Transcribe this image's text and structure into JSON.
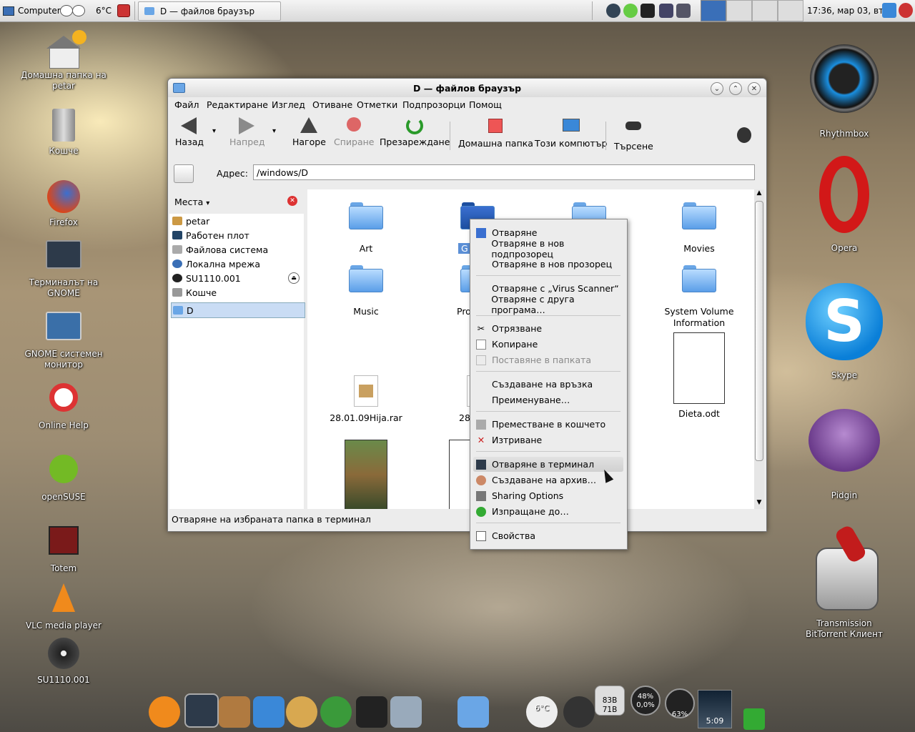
{
  "top_panel": {
    "computer": "Computer",
    "weather": "6°C",
    "task": "D — файлов браузър",
    "clock": "17:36, мар 03, вт"
  },
  "desktop_left": [
    {
      "label": "Домашна папка на petar",
      "icon": "home-folder-icon"
    },
    {
      "label": "Кошче",
      "icon": "trash-icon"
    },
    {
      "label": "Firefox",
      "icon": "firefox-icon"
    },
    {
      "label": "Терминалът на GNOME",
      "icon": "terminal-icon"
    },
    {
      "label": "GNOME системен монитор",
      "icon": "system-monitor-icon"
    },
    {
      "label": "Online Help",
      "icon": "help-icon"
    },
    {
      "label": "openSUSE",
      "icon": "opensuse-icon"
    },
    {
      "label": "Totem",
      "icon": "totem-icon"
    },
    {
      "label": "VLC media player",
      "icon": "vlc-icon"
    },
    {
      "label": "SU1110.001",
      "icon": "cd-icon"
    }
  ],
  "desktop_right": [
    {
      "label": "Rhythmbox",
      "icon": "rhythmbox-icon"
    },
    {
      "label": "Opera",
      "icon": "opera-icon"
    },
    {
      "label": "Skype",
      "icon": "skype-icon"
    },
    {
      "label": "Pidgin",
      "icon": "pidgin-icon"
    },
    {
      "label": "Transmission BitTorrent Клиент",
      "icon": "transmission-icon"
    }
  ],
  "window": {
    "title": "D — файлов браузър",
    "menu": [
      "Файл",
      "Редактиране",
      "Изглед",
      "Отиване",
      "Отметки",
      "Подпрозорци",
      "Помощ"
    ],
    "toolbar": {
      "back": "Назад",
      "forward": "Напред",
      "up": "Нагоре",
      "stop": "Спиране",
      "reload": "Презареждане",
      "home": "Домашна папка",
      "computer": "Този компютър",
      "search": "Търсене"
    },
    "address_label": "Адрес:",
    "address_value": "/windows/D",
    "places_title": "Места",
    "places": [
      "petar",
      "Работен плот",
      "Файлова система",
      "Локална мрежа",
      "SU1110.001",
      "Кошче",
      "D"
    ],
    "files": {
      "art": "Art",
      "music": "Music",
      "movies": "Movies",
      "system_volume": "System Volume Information",
      "rar": "28.01.09Hija.rar",
      "dieta": "Dieta.odt",
      "g_partial": "G",
      "pro_partial": "Pro",
      "num_partial": "28"
    },
    "status": "Отваряне на избраната папка в терминал"
  },
  "context_menu": [
    "Отваряне",
    "Отваряне в нов подпрозорец",
    "Отваряне в нов прозорец",
    "Отваряне с „Virus Scanner“",
    "Отваряне с друга програма…",
    "Отрязване",
    "Копиране",
    "Поставяне в папката",
    "Създаване на връзка",
    "Преименуване…",
    "Преместване в кошчето",
    "Изтриване",
    "Отваряне в терминал",
    "Създаване на архив…",
    "Sharing Options",
    "Изпращане до…",
    "Свойства"
  ],
  "dock": {
    "weather": "6°C",
    "disk_top": "83B",
    "disk_bottom": "71B",
    "cpu_top": "48%",
    "cpu_bottom": "0,0%",
    "mem": "63%",
    "media_time": "5:09"
  },
  "colors": {
    "selection": "#5b8fd6",
    "folder": "#6aa6e6",
    "panel": "#e4e4e4"
  }
}
